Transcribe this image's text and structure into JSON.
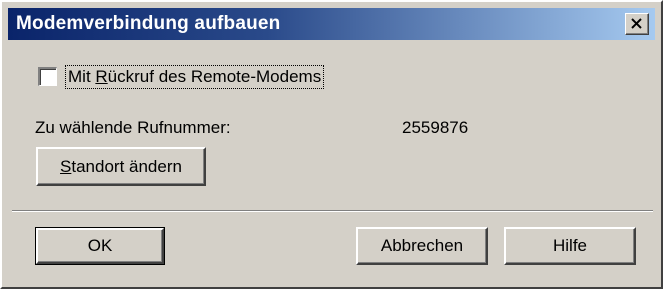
{
  "window": {
    "title": "Modemverbindung aufbauen",
    "close_icon": "close-x-icon"
  },
  "callback": {
    "checked": false,
    "label_mnemonic": "R",
    "label_pre": "Mit ",
    "label_post": "ückruf des Remote-Modems"
  },
  "dial": {
    "label": "Zu wählende Rufnummer:",
    "number": "2559876"
  },
  "buttons": {
    "location_mnemonic": "S",
    "location_rest": "tandort ändern",
    "ok": "OK",
    "cancel": "Abbrechen",
    "help": "Hilfe"
  },
  "colors": {
    "face": "#d4d0c8",
    "title_start": "#0a246a",
    "title_end": "#a6caf0"
  }
}
